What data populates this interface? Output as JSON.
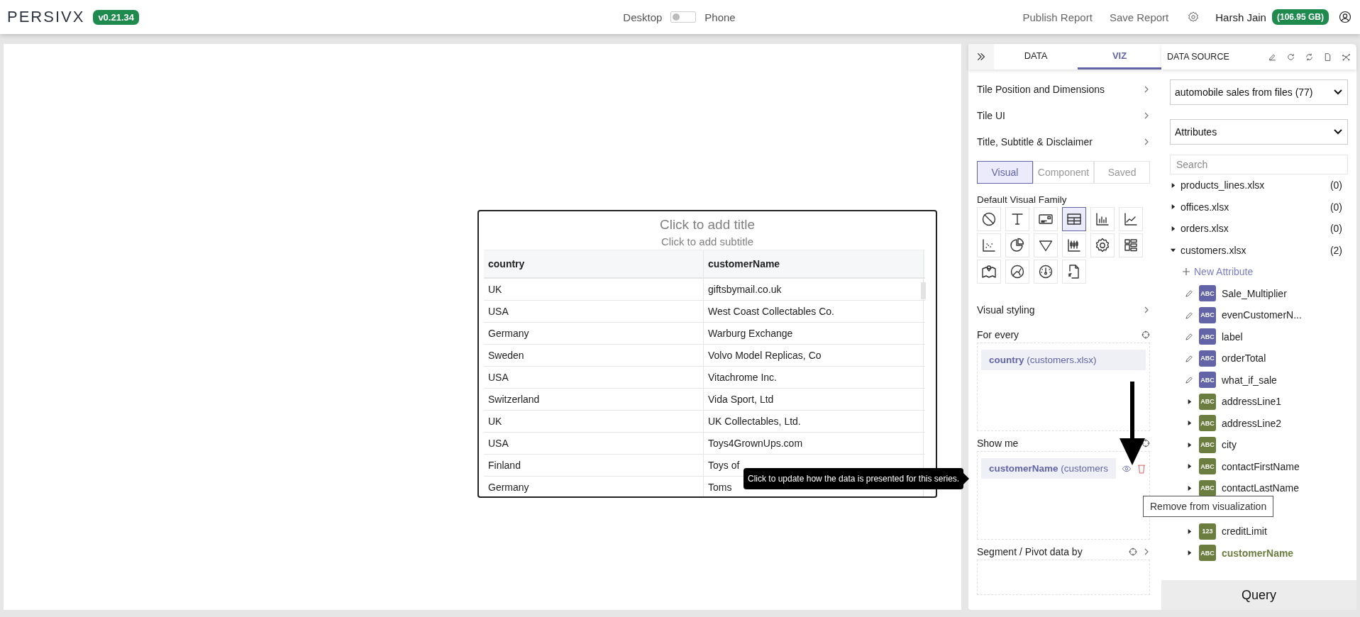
{
  "header": {
    "logo": "PERSIVX",
    "version": "v0.21.34",
    "view_toggle": {
      "left": "Desktop",
      "right": "Phone",
      "on": false
    },
    "actions": [
      "Publish Report",
      "Save Report"
    ],
    "user": "Harsh Jain",
    "storage": "(106.95 GB)"
  },
  "tile": {
    "title_placeholder": "Click to add title",
    "subtitle_placeholder": "Click to add subtitle",
    "columns": [
      "country",
      "customerName"
    ],
    "rows": [
      [
        "UK",
        "giftsbymail.co.uk"
      ],
      [
        "USA",
        "West Coast Collectables Co."
      ],
      [
        "Germany",
        "Warburg Exchange"
      ],
      [
        "Sweden",
        "Volvo Model Replicas, Co"
      ],
      [
        "USA",
        "Vitachrome Inc."
      ],
      [
        "Switzerland",
        "Vida Sport, Ltd"
      ],
      [
        "UK",
        "UK Collectables, Ltd."
      ],
      [
        "USA",
        "Toys4GrownUps.com"
      ],
      [
        "Finland",
        "Toys of"
      ],
      [
        "Germany",
        "Toms"
      ]
    ]
  },
  "viz_panel": {
    "tabs": [
      {
        "label": "DATA",
        "selected": false
      },
      {
        "label": "VIZ",
        "selected": true
      }
    ],
    "sections": [
      "Tile Position and Dimensions",
      "Tile UI",
      "Title, Subtitle & Disclaimer"
    ],
    "modes": [
      {
        "label": "Visual",
        "selected": true
      },
      {
        "label": "Component",
        "selected": false
      },
      {
        "label": "Saved",
        "selected": false
      }
    ],
    "family_label": "Default Visual Family",
    "visual_types": [
      {
        "kind": "none",
        "selected": false
      },
      {
        "kind": "text",
        "selected": false
      },
      {
        "kind": "card",
        "selected": false
      },
      {
        "kind": "table",
        "selected": true
      },
      {
        "kind": "bar",
        "selected": false
      },
      {
        "kind": "line",
        "selected": false
      },
      {
        "kind": "scatter",
        "selected": false
      },
      {
        "kind": "pie",
        "selected": false
      },
      {
        "kind": "funnel",
        "selected": false
      },
      {
        "kind": "boxplot",
        "selected": false
      },
      {
        "kind": "gear",
        "selected": false
      },
      {
        "kind": "layout",
        "selected": false
      },
      {
        "kind": "map",
        "selected": false
      },
      {
        "kind": "network",
        "selected": false
      },
      {
        "kind": "gauge",
        "selected": false
      },
      {
        "kind": "script",
        "selected": false
      }
    ],
    "styling_label": "Visual styling",
    "for_every": {
      "label": "For every",
      "fields": [
        {
          "name": "country",
          "source": "(customers.xlsx)"
        }
      ]
    },
    "show_me": {
      "label": "Show me",
      "fields": [
        {
          "name": "customerName",
          "source": "(customers"
        }
      ]
    },
    "segment": {
      "label": "Segment / Pivot data by"
    }
  },
  "data_source": {
    "title": "DATA SOURCE",
    "source_select": "automobile sales from files (77)",
    "type_select": "Attributes",
    "search_placeholder": "Search",
    "tree": [
      {
        "name": "products_lines.xlsx",
        "count": "(0)",
        "expanded": false
      },
      {
        "name": "offices.xlsx",
        "count": "(0)",
        "expanded": false
      },
      {
        "name": "orders.xlsx",
        "count": "(0)",
        "expanded": false
      },
      {
        "name": "customers.xlsx",
        "count": "(2)",
        "expanded": true,
        "new_attribute": "New Attribute",
        "children": [
          {
            "name": "Sale_Multiplier",
            "kind": "custom",
            "type": "ABC",
            "selected": false
          },
          {
            "name": "evenCustomerN...",
            "kind": "custom",
            "type": "ABC",
            "selected": false
          },
          {
            "name": "label",
            "kind": "custom",
            "type": "ABC",
            "selected": false
          },
          {
            "name": "orderTotal",
            "kind": "custom",
            "type": "ABC",
            "selected": false
          },
          {
            "name": "what_if_sale",
            "kind": "custom",
            "type": "ABC",
            "selected": false
          },
          {
            "name": "addressLine1",
            "kind": "field",
            "type": "ABC",
            "selected": false
          },
          {
            "name": "addressLine2",
            "kind": "field",
            "type": "ABC",
            "selected": false
          },
          {
            "name": "city",
            "kind": "field",
            "type": "ABC",
            "selected": false
          },
          {
            "name": "contactFirstName",
            "kind": "field",
            "type": "ABC",
            "selected": false
          },
          {
            "name": "contactLastName",
            "kind": "field",
            "type": "ABC",
            "selected": false
          },
          {
            "kind": "covered"
          },
          {
            "name": "creditLimit",
            "kind": "field",
            "type": "123",
            "selected": false
          },
          {
            "name": "customerName",
            "kind": "field",
            "type": "ABC",
            "selected": true
          }
        ]
      }
    ],
    "query_button": "Query"
  },
  "tooltips": [
    {
      "kind": "dark",
      "text": "Click to update how the data is presented for this series."
    },
    {
      "kind": "light",
      "text": "Remove from visualization"
    }
  ]
}
